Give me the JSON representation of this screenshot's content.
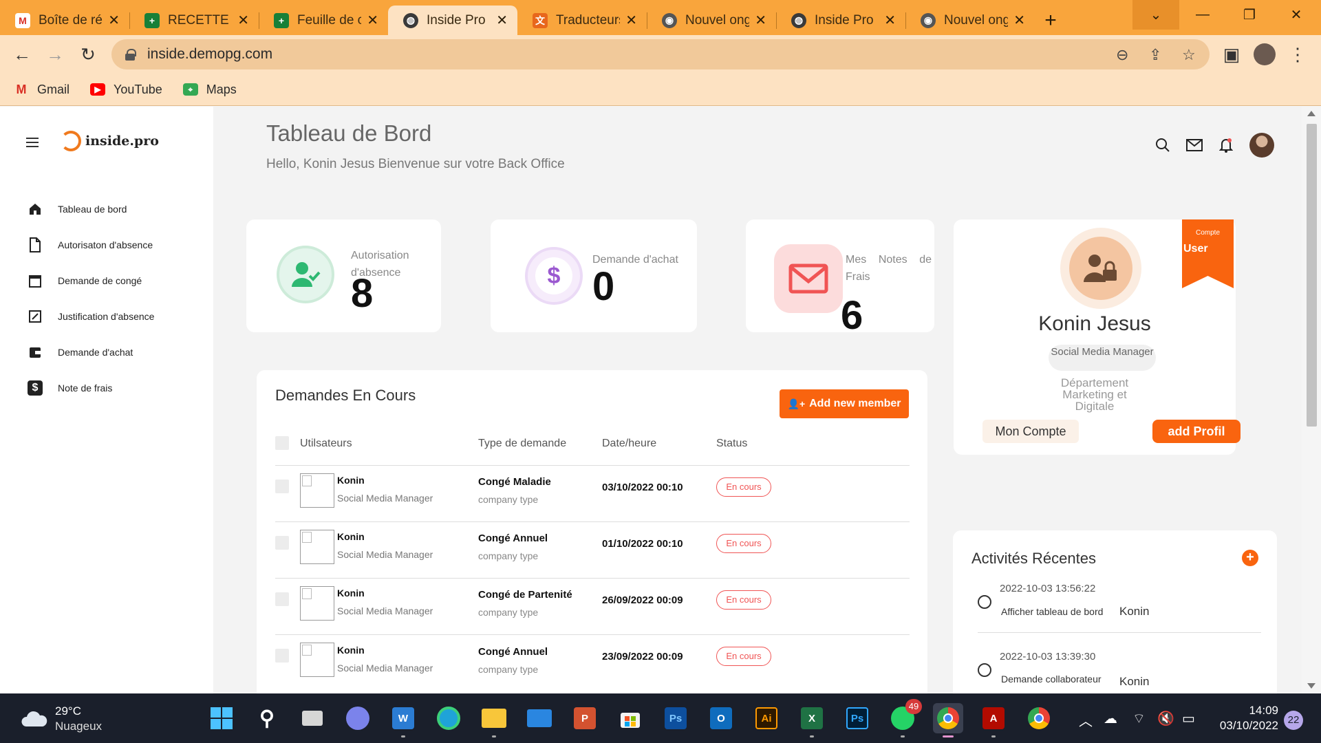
{
  "browser": {
    "tabs": [
      {
        "title": "Boîte de réc",
        "icon": "gmail-icon",
        "color": "#d93025"
      },
      {
        "title": "RECETTE IN",
        "icon": "sheets-icon",
        "color": "#188038"
      },
      {
        "title": "Feuille de c",
        "icon": "sheets-icon",
        "color": "#188038"
      },
      {
        "title": "Inside Pro",
        "icon": "globe-icon",
        "color": "#3a3a3a"
      },
      {
        "title": "Traducteurs",
        "icon": "translate-icon",
        "color": "#e8671c"
      },
      {
        "title": "Nouvel ong",
        "icon": "chrome-icon",
        "color": "#555555"
      },
      {
        "title": "Inside Pro",
        "icon": "globe-icon",
        "color": "#3a3a3a"
      },
      {
        "title": "Nouvel ong",
        "icon": "chrome-icon",
        "color": "#555555"
      }
    ],
    "url": "inside.demopg.com",
    "bookmarks": [
      {
        "label": "Gmail",
        "icon": "gmail-icon"
      },
      {
        "label": "YouTube",
        "icon": "youtube-icon"
      },
      {
        "label": "Maps",
        "icon": "maps-icon"
      }
    ]
  },
  "sidebar": {
    "logo": "inside.pro",
    "items": [
      {
        "label": "Tableau de bord",
        "icon": "home-icon"
      },
      {
        "label": "Autorisaton d'absence",
        "icon": "document-icon"
      },
      {
        "label": "Demande de congé",
        "icon": "calendar-icon"
      },
      {
        "label": "Justification d'absence",
        "icon": "edit-icon"
      },
      {
        "label": "Demande d'achat",
        "icon": "wallet-icon"
      },
      {
        "label": "Note de frais",
        "icon": "dollar-icon"
      }
    ]
  },
  "header": {
    "title": "Tableau de Bord",
    "subtitle": "Hello, Konin Jesus Bienvenue sur votre Back Office"
  },
  "stats": {
    "absence": {
      "label": "Autorisation d'absence",
      "value": "8",
      "color": "#2eb872"
    },
    "achat": {
      "label": "Demande d'achat",
      "value": "0",
      "color": "#9b59d0"
    },
    "frais": {
      "label": "Mes Notes de Frais",
      "value": "6",
      "color": "#f05454"
    }
  },
  "profile": {
    "ribbon_small": "Compte",
    "ribbon_label": "User",
    "name": "Konin Jesus",
    "role": "Social Media Manager",
    "department": "Département Marketing et Digitale",
    "btn_account": "Mon Compte",
    "btn_add": "add Profil"
  },
  "requests": {
    "title": "Demandes En Cours",
    "add_button": "Add new member",
    "columns": [
      "Utilsateurs",
      "Type de demande",
      "Date/heure",
      "Status"
    ],
    "rows": [
      {
        "user": "Konin",
        "role": "Social Media Manager",
        "type": "Congé Maladie",
        "subtype": "company type",
        "date": "03/10/2022 00:10",
        "status": "En cours"
      },
      {
        "user": "Konin",
        "role": "Social Media Manager",
        "type": "Congé Annuel",
        "subtype": "company type",
        "date": "01/10/2022 00:10",
        "status": "En cours"
      },
      {
        "user": "Konin",
        "role": "Social Media Manager",
        "type": "Congé de Partenité",
        "subtype": "company type",
        "date": "26/09/2022 00:09",
        "status": "En cours"
      },
      {
        "user": "Konin",
        "role": "Social Media Manager",
        "type": "Congé Annuel",
        "subtype": "company type",
        "date": "23/09/2022 00:09",
        "status": "En cours"
      }
    ]
  },
  "activities": {
    "title": "Activités Récentes",
    "items": [
      {
        "time": "2022-10-03 13:56:22",
        "text": "Afficher tableau de bord",
        "user": "Konin"
      },
      {
        "time": "2022-10-03 13:39:30",
        "text": "Demande collaborateur",
        "user": "Konin"
      }
    ]
  },
  "taskbar": {
    "weather_temp": "29°C",
    "weather_cond": "Nuageux",
    "whatsapp_badge": "49",
    "time": "14:09",
    "date": "03/10/2022",
    "notifications": "22"
  },
  "accent_color": "#f9640f"
}
